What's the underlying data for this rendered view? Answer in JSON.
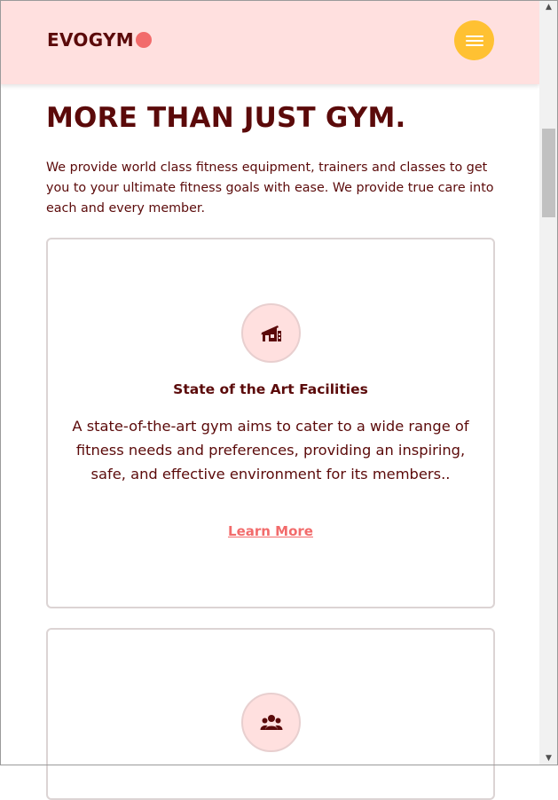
{
  "header": {
    "logo_text": "EVOGYM",
    "menu_icon": "hamburger-menu-icon"
  },
  "colors": {
    "header_bg": "#ffe0df",
    "primary_dark": "#5b0a0a",
    "accent_red": "#f26b6b",
    "accent_yellow": "#ffc132"
  },
  "main": {
    "title": "MORE THAN JUST GYM.",
    "intro": "We provide world class fitness equipment, trainers and classes to get you to your ultimate fitness goals with ease. We provide true care into each and every member."
  },
  "cards": [
    {
      "icon": "home-modern-icon",
      "title": "State of the Art Facilities",
      "text": "A state-of-the-art gym aims to cater to a wide range of fitness needs and preferences, providing an inspiring, safe, and effective environment for its members..",
      "link": "Learn More"
    },
    {
      "icon": "user-group-icon"
    }
  ]
}
